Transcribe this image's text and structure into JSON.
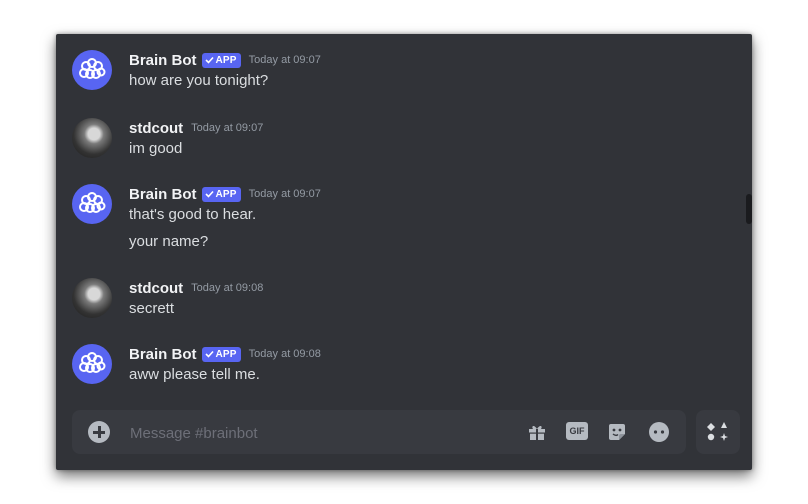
{
  "messages": [
    {
      "author": "Brain Bot",
      "badge": "APP",
      "timestamp": "Today at 09:07",
      "lines": [
        "how are you tonight?"
      ],
      "is_bot": true
    },
    {
      "author": "stdcout",
      "badge": "",
      "timestamp": "Today at 09:07",
      "lines": [
        "im good"
      ],
      "is_bot": false
    },
    {
      "author": "Brain Bot",
      "badge": "APP",
      "timestamp": "Today at 09:07",
      "lines": [
        "that's good to hear.",
        "your name?"
      ],
      "is_bot": true
    },
    {
      "author": "stdcout",
      "badge": "",
      "timestamp": "Today at 09:08",
      "lines": [
        "secrett"
      ],
      "is_bot": false
    },
    {
      "author": "Brain Bot",
      "badge": "APP",
      "timestamp": "Today at 09:08",
      "lines": [
        "aww please tell me."
      ],
      "is_bot": true
    }
  ],
  "composer": {
    "placeholder": "Message #brainbot",
    "value": "",
    "icons": [
      "plus-circle-icon",
      "gift-icon",
      "gif-icon",
      "sticker-icon",
      "emoji-icon"
    ],
    "gif_label": "GIF"
  },
  "apps_button": {
    "icon": "app-launcher-icon"
  },
  "colors": {
    "background": "#313338",
    "composer": "#383a40",
    "blurple": "#5865f2",
    "text": "#dbdee1",
    "muted": "#949ba4"
  }
}
